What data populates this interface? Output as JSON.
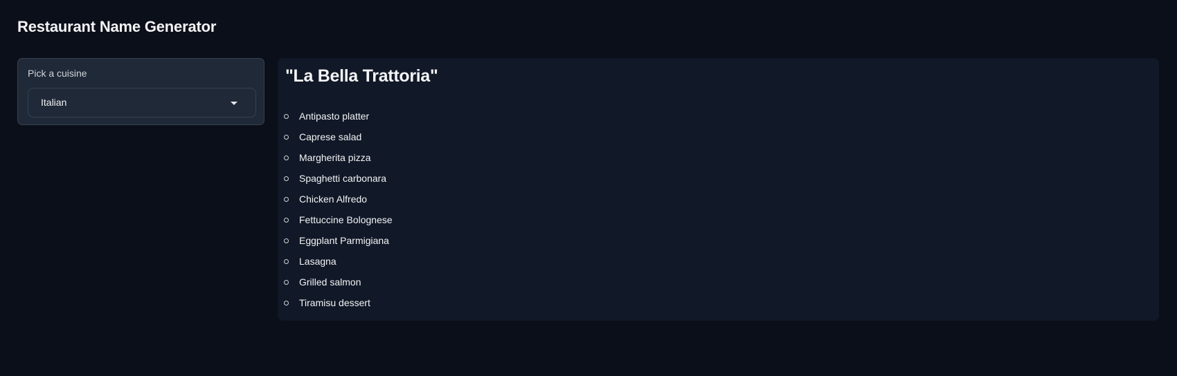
{
  "app": {
    "title": "Restaurant Name Generator"
  },
  "input": {
    "label": "Pick a cuisine",
    "selected": "Italian",
    "dropdown_icon": "caret-down-icon"
  },
  "output": {
    "restaurant_name": "\"La Bella Trattoria\"",
    "menu_items": [
      "Antipasto platter",
      "Caprese salad",
      "Margherita pizza",
      "Spaghetti carbonara",
      "Chicken Alfredo",
      "Fettuccine Bolognese",
      "Eggplant Parmigiana",
      "Lasagna",
      "Grilled salmon",
      "Tiramisu dessert"
    ],
    "bullet_icon": "hollow-circle-bullet-icon"
  }
}
